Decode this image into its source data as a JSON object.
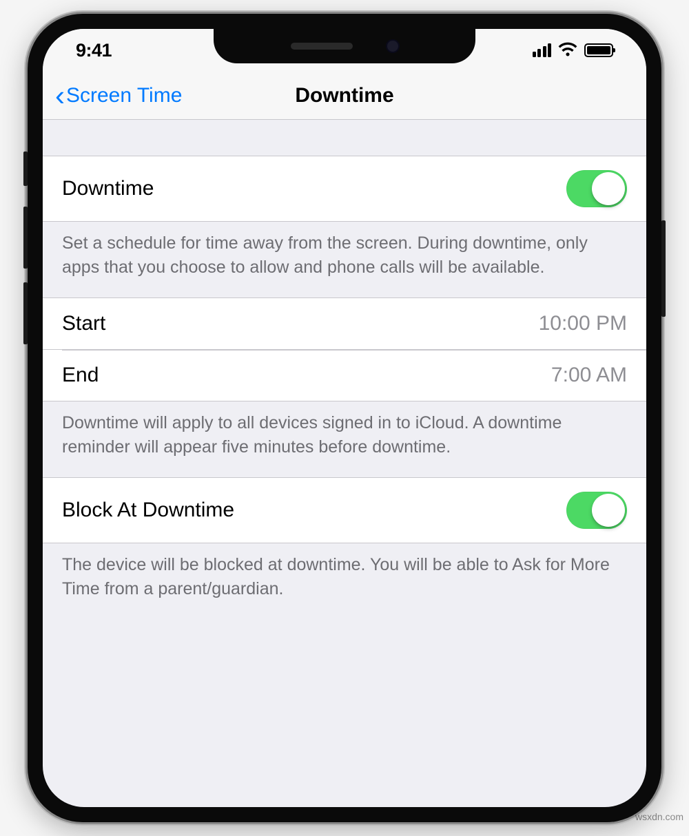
{
  "statusBar": {
    "time": "9:41"
  },
  "nav": {
    "back": "Screen Time",
    "title": "Downtime"
  },
  "downtimeToggle": {
    "label": "Downtime",
    "enabled": true
  },
  "downtimeDescription": "Set a schedule for time away from the screen. During downtime, only apps that you choose to allow and phone calls will be available.",
  "schedule": {
    "startLabel": "Start",
    "startValue": "10:00 PM",
    "endLabel": "End",
    "endValue": "7:00 AM"
  },
  "scheduleDescription": "Downtime will apply to all devices signed in to iCloud. A downtime reminder will appear five minutes before downtime.",
  "blockToggle": {
    "label": "Block At Downtime",
    "enabled": true
  },
  "blockDescription": "The device will be blocked at downtime. You will be able to Ask for More Time from a parent/guardian.",
  "watermark": "wsxdn.com"
}
